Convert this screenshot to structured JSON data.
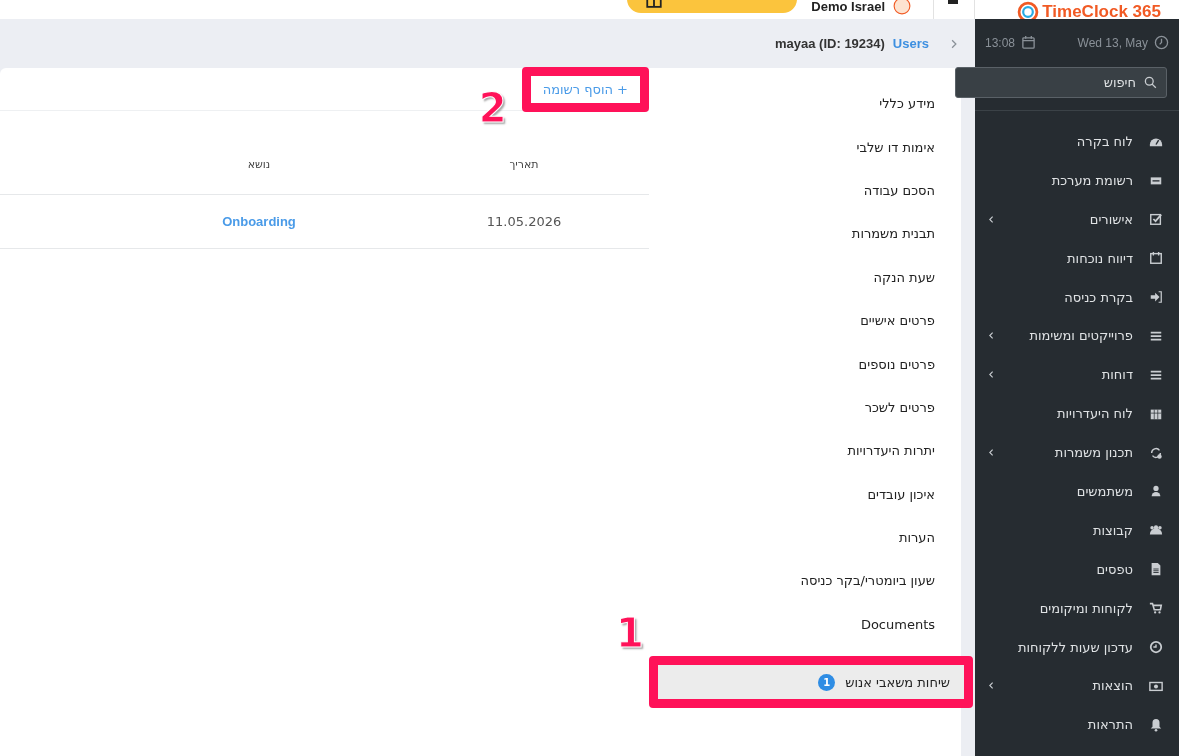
{
  "header": {
    "logo": "TimeClock 365",
    "account": "Demo Israel"
  },
  "sidebar": {
    "time": "13:08",
    "date": "Wed 13, May",
    "search": {
      "placeholder": "חיפוש"
    },
    "items": [
      {
        "label": "לוח בקרה",
        "has_submenu": false
      },
      {
        "label": "רשומת מערכת",
        "has_submenu": false
      },
      {
        "label": "אישורים",
        "has_submenu": true
      },
      {
        "label": "דיווח נוכחות",
        "has_submenu": false
      },
      {
        "label": "בקרת כניסה",
        "has_submenu": false
      },
      {
        "label": "פרוייקטים ומשימות",
        "has_submenu": true
      },
      {
        "label": "דוחות",
        "has_submenu": true
      },
      {
        "label": "לוח היעדרויות",
        "has_submenu": false
      },
      {
        "label": "תכנון משמרות",
        "has_submenu": true
      },
      {
        "label": "משתמשים",
        "has_submenu": false
      },
      {
        "label": "קבוצות",
        "has_submenu": false
      },
      {
        "label": "טפסים",
        "has_submenu": false
      },
      {
        "label": "לקוחות ומיקומים",
        "has_submenu": false
      },
      {
        "label": "עדכון שעות ללקוחות",
        "has_submenu": false
      },
      {
        "label": "הוצאות",
        "has_submenu": true
      },
      {
        "label": "התראות",
        "has_submenu": false
      }
    ]
  },
  "breadcrumb": {
    "section": "Users",
    "current": "mayaa (ID: 19234)"
  },
  "user_tabs": [
    {
      "label": "מידע כללי",
      "selected": false
    },
    {
      "label": "אימות דו שלבי",
      "selected": false
    },
    {
      "label": "הסכם עבודה",
      "selected": false
    },
    {
      "label": "תבנית משמרות",
      "selected": false
    },
    {
      "label": "שעת הנקה",
      "selected": false
    },
    {
      "label": "פרטים אישיים",
      "selected": false
    },
    {
      "label": "פרטים נוספים",
      "selected": false
    },
    {
      "label": "פרטים לשכר",
      "selected": false
    },
    {
      "label": "יתרות היעדרויות",
      "selected": false
    },
    {
      "label": "איכון עובדים",
      "selected": false
    },
    {
      "label": "הערות",
      "selected": false
    },
    {
      "label": "שעון ביומטרי/בקר כניסה",
      "selected": false
    },
    {
      "label": "Documents",
      "selected": false
    },
    {
      "label": "שיחות משאבי אנוש",
      "selected": true,
      "badge": "1"
    }
  ],
  "add_record": "+ הוסף רשומה",
  "table": {
    "columns": [
      "תאריך",
      "נושא"
    ],
    "rows": [
      [
        "11.05.2026",
        "Onboarding"
      ]
    ]
  },
  "callouts": [
    "1",
    "2"
  ]
}
